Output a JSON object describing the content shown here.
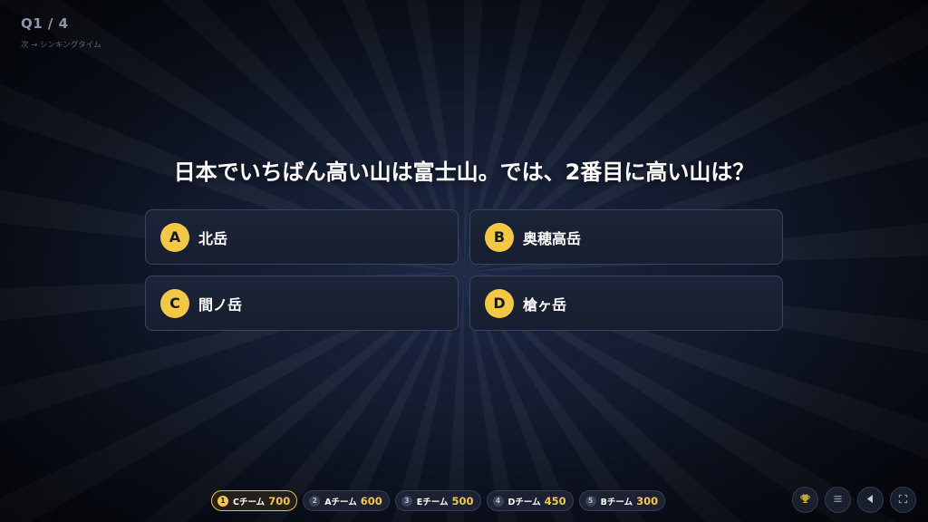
{
  "header": {
    "progress": "Q1 / 4",
    "next_hint": "次 → シンキングタイム"
  },
  "question": {
    "text": "日本でいちばん高い山は富士山。では、2番目に高い山は？"
  },
  "answers": [
    {
      "letter": "A",
      "text": "北岳"
    },
    {
      "letter": "B",
      "text": "奥穂高岳"
    },
    {
      "letter": "C",
      "text": "間ノ岳"
    },
    {
      "letter": "D",
      "text": "槍ヶ岳"
    }
  ],
  "scoreboard": [
    {
      "rank": "1",
      "name": "Cチーム",
      "score": "700"
    },
    {
      "rank": "2",
      "name": "Aチーム",
      "score": "600"
    },
    {
      "rank": "3",
      "name": "Eチーム",
      "score": "500"
    },
    {
      "rank": "4",
      "name": "Dチーム",
      "score": "450"
    },
    {
      "rank": "5",
      "name": "Bチーム",
      "score": "300"
    }
  ],
  "controls": [
    {
      "icon": "trophy-icon"
    },
    {
      "icon": "menu-icon"
    },
    {
      "icon": "back-icon"
    },
    {
      "icon": "fullscreen-icon"
    }
  ],
  "colors": {
    "accent": "#f3c845",
    "background": "#0d1322",
    "card": "#1c2438",
    "card_border": "#3a4460"
  }
}
